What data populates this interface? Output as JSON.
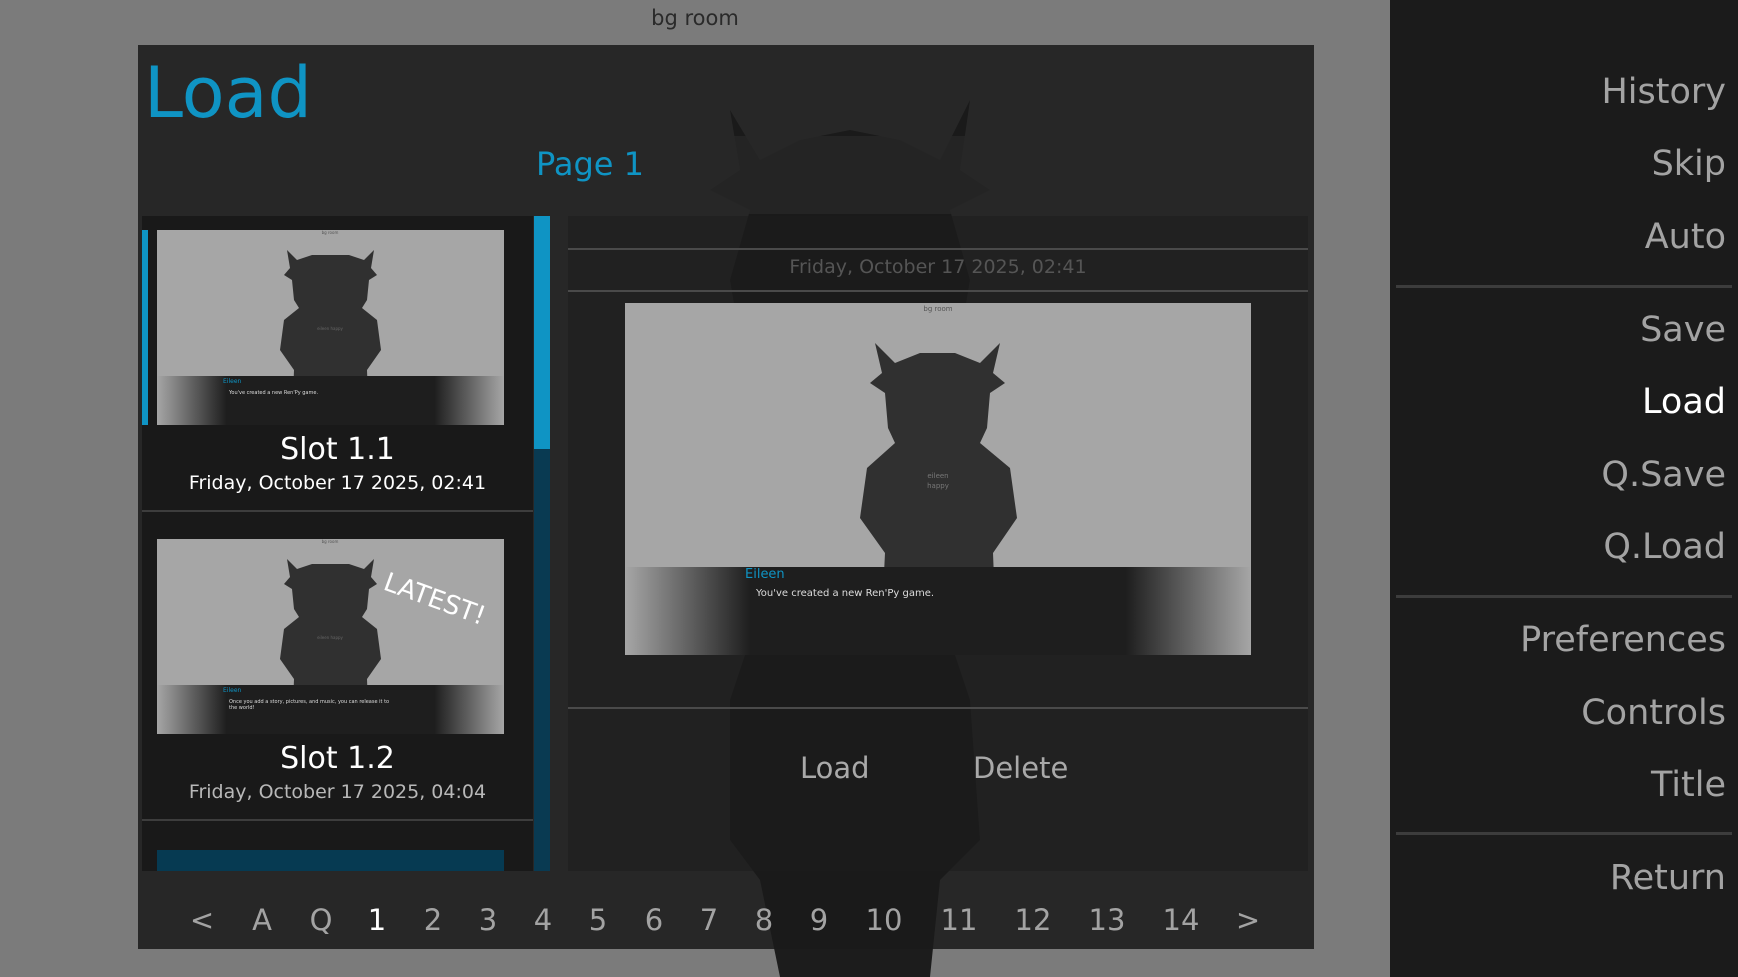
{
  "scene": {
    "label": "bg room"
  },
  "screen": {
    "title": "Load",
    "page_label": "Page 1"
  },
  "slots": [
    {
      "name": "Slot 1.1",
      "date": "Friday, October 17 2025, 02:41",
      "selected": true,
      "thumb": {
        "bg_label": "bg room",
        "speaker": "Eileen",
        "line1": "You've created a new Ren'Py game.",
        "line2": "",
        "sprite_text": "eileen happy"
      }
    },
    {
      "name": "Slot 1.2",
      "date": "Friday, October 17 2025, 04:04",
      "selected": false,
      "badge": "LATEST!",
      "thumb": {
        "bg_label": "bg room",
        "speaker": "Eileen",
        "line1": "Once you add a story, pictures, and music, you can release it to",
        "line2": "the world!",
        "sprite_text": "eileen happy"
      }
    }
  ],
  "detail": {
    "date": "Friday, October 17 2025, 02:41",
    "preview": {
      "bg_label": "bg room",
      "speaker": "Eileen",
      "line": "You've created a new Ren'Py game.",
      "sprite_line1": "eileen",
      "sprite_line2": "happy"
    },
    "load_label": "Load",
    "delete_label": "Delete"
  },
  "pager": {
    "items": [
      "<",
      "A",
      "Q",
      "1",
      "2",
      "3",
      "4",
      "5",
      "6",
      "7",
      "8",
      "9",
      "10",
      "11",
      "12",
      "13",
      "14",
      ">"
    ],
    "current": "1"
  },
  "nav": {
    "history": "History",
    "skip": "Skip",
    "auto": "Auto",
    "save": "Save",
    "load": "Load",
    "qsave": "Q.Save",
    "qload": "Q.Load",
    "preferences": "Preferences",
    "controls": "Controls",
    "title": "Title",
    "return": "Return"
  },
  "colors": {
    "accent": "#0f94c4",
    "nav_bg": "#1b1b1b",
    "panel_bg": "#1a1a1a",
    "scene_bg": "#7b7b7b"
  }
}
